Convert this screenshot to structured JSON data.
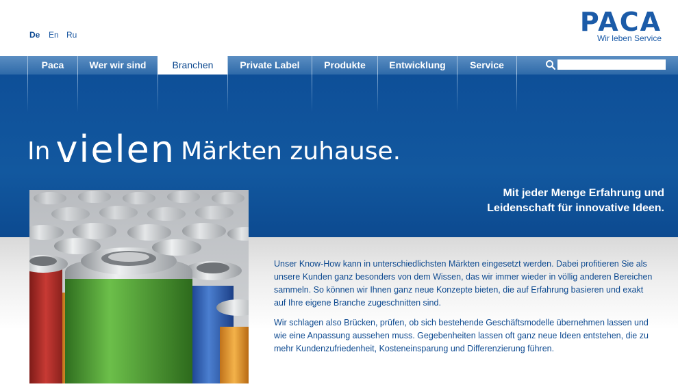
{
  "languages": [
    {
      "label": "De",
      "active": true
    },
    {
      "label": "En",
      "active": false
    },
    {
      "label": "Ru",
      "active": false
    }
  ],
  "logo": {
    "word": "PACA",
    "tagline": "Wir leben Service"
  },
  "nav": {
    "items": [
      {
        "label": "Paca",
        "active": false
      },
      {
        "label": "Wer wir sind",
        "active": false
      },
      {
        "label": "Branchen",
        "active": true
      },
      {
        "label": "Private Label",
        "active": false
      },
      {
        "label": "Produkte",
        "active": false
      },
      {
        "label": "Entwicklung",
        "active": false
      },
      {
        "label": "Service",
        "active": false
      }
    ],
    "search": {
      "placeholder": "",
      "value": ""
    }
  },
  "hero": {
    "headline_pre": "In",
    "headline_big": "vielen",
    "headline_post": "Märkten zuhause.",
    "tagline_line1": "Mit jeder Menge Erfahrung und",
    "tagline_line2": "Leidenschaft für innovative Ideen."
  },
  "content": {
    "paragraph1": "Unser Know-How kann in unterschiedlichsten Märkten eingesetzt werden. Dabei profitieren Sie als unsere Kunden ganz besonders von dem Wissen, das wir immer wieder in völlig anderen Bereichen sammeln. So können wir Ihnen ganz neue Konzepte bieten, die auf Erfahrung basieren und exakt auf Ihre eigene Branche zugeschnitten sind.",
    "paragraph2": "Wir schlagen also Brücken, prüfen, ob sich bestehende Geschäftsmodelle übernehmen lassen und wie eine Anpassung aussehen muss. Gegebenheiten lassen oft ganz neue Ideen entstehen, die zu mehr Kundenzufriedenheit, Kosteneinsparung und Differenzierung führen."
  },
  "colors": {
    "brand_blue": "#1b5ba8",
    "hero_blue": "#12589f",
    "text_blue": "#0e4a90",
    "can_green": "#4f9a35",
    "can_red": "#b8322e",
    "can_blue": "#2f63b8",
    "can_orange": "#e39a2a"
  }
}
